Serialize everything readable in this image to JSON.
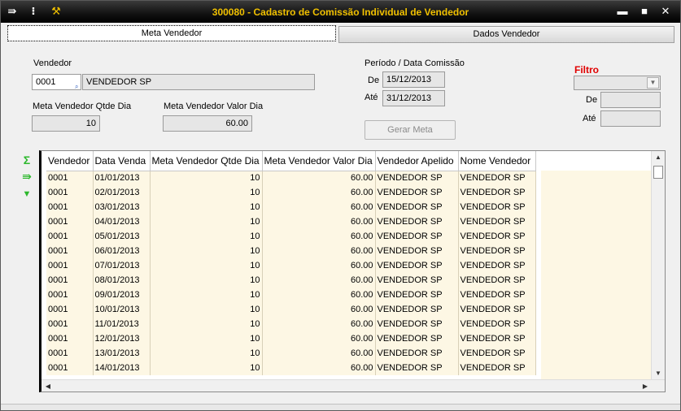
{
  "window": {
    "title": "300080 - Cadastro de Comissão Individual de Vendedor",
    "icons": [
      "export-icon",
      "traffic-light-icon",
      "wrench-icon"
    ],
    "controls": {
      "minimize": "▬",
      "maximize": "■",
      "close": "✕"
    }
  },
  "tabs": [
    {
      "label": "Meta Vendedor",
      "active": true
    },
    {
      "label": "Dados Vendedor",
      "active": false
    }
  ],
  "form": {
    "vendedor_label": "Vendedor",
    "vendedor_code": "0001",
    "vendedor_name": "VENDEDOR SP",
    "meta_qtde_label": "Meta Vendedor Qtde Dia",
    "meta_qtde_value": "10",
    "meta_valor_label": "Meta Vendedor Valor Dia",
    "meta_valor_value": "60.00",
    "periodo_label": "Período / Data Comissão",
    "de_label": "De",
    "de_value": "15/12/2013",
    "ate_label": "Até",
    "ate_value": "31/12/2013",
    "gerar_meta_label": "Gerar Meta",
    "filtro_label": "Filtro",
    "filtro_de_label": "De",
    "filtro_ate_label": "Até"
  },
  "colors": {
    "title_text": "#f0c000",
    "filtro_label": "#e00000",
    "row_bg": "#fdf7e4",
    "side_icon_green": "#2db82d"
  },
  "grid": {
    "columns": [
      "Vendedor",
      "Data Venda",
      "Meta Vendedor Qtde Dia",
      "Meta Vendedor Valor Dia",
      "Vendedor Apelido",
      "Nome Vendedor"
    ],
    "rows": [
      [
        "0001",
        "01/01/2013",
        "10",
        "60.00",
        "VENDEDOR SP",
        "VENDEDOR SP"
      ],
      [
        "0001",
        "02/01/2013",
        "10",
        "60.00",
        "VENDEDOR SP",
        "VENDEDOR SP"
      ],
      [
        "0001",
        "03/01/2013",
        "10",
        "60.00",
        "VENDEDOR SP",
        "VENDEDOR SP"
      ],
      [
        "0001",
        "04/01/2013",
        "10",
        "60.00",
        "VENDEDOR SP",
        "VENDEDOR SP"
      ],
      [
        "0001",
        "05/01/2013",
        "10",
        "60.00",
        "VENDEDOR SP",
        "VENDEDOR SP"
      ],
      [
        "0001",
        "06/01/2013",
        "10",
        "60.00",
        "VENDEDOR SP",
        "VENDEDOR SP"
      ],
      [
        "0001",
        "07/01/2013",
        "10",
        "60.00",
        "VENDEDOR SP",
        "VENDEDOR SP"
      ],
      [
        "0001",
        "08/01/2013",
        "10",
        "60.00",
        "VENDEDOR SP",
        "VENDEDOR SP"
      ],
      [
        "0001",
        "09/01/2013",
        "10",
        "60.00",
        "VENDEDOR SP",
        "VENDEDOR SP"
      ],
      [
        "0001",
        "10/01/2013",
        "10",
        "60.00",
        "VENDEDOR SP",
        "VENDEDOR SP"
      ],
      [
        "0001",
        "11/01/2013",
        "10",
        "60.00",
        "VENDEDOR SP",
        "VENDEDOR SP"
      ],
      [
        "0001",
        "12/01/2013",
        "10",
        "60.00",
        "VENDEDOR SP",
        "VENDEDOR SP"
      ],
      [
        "0001",
        "13/01/2013",
        "10",
        "60.00",
        "VENDEDOR SP",
        "VENDEDOR SP"
      ],
      [
        "0001",
        "14/01/2013",
        "10",
        "60.00",
        "VENDEDOR SP",
        "VENDEDOR SP"
      ]
    ]
  }
}
